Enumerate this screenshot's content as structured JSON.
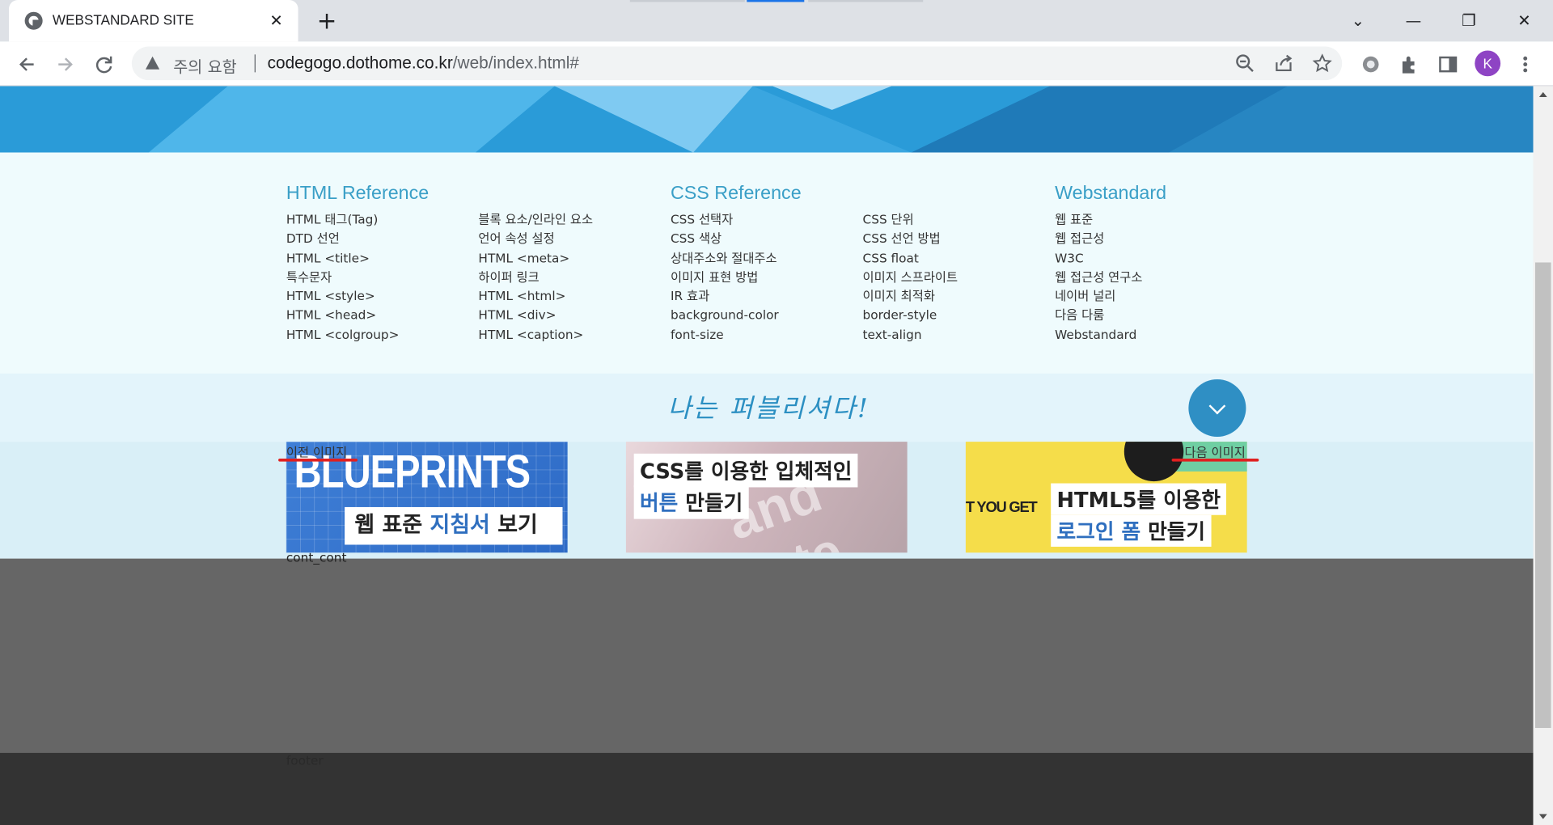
{
  "browser": {
    "tab_title": "WEBSTANDARD SITE",
    "tab_close_glyph": "✕",
    "new_tab_glyph": "+",
    "window_buttons": {
      "tab_search": "⌄",
      "minimize": "—",
      "restore": "❐",
      "close": "✕"
    },
    "security_warning": "주의 요함",
    "url_host": "codegogo.dothome.co.kr",
    "url_path": "/web/index.html#",
    "profile_initial": "K",
    "icons": {
      "back": "arrow-left-icon",
      "forward": "arrow-right-icon",
      "reload": "reload-icon",
      "warning": "warning-triangle-icon",
      "zoom": "zoom-out-icon",
      "share": "share-icon",
      "bookmark": "star-icon",
      "extension1": "gear-extension-icon",
      "extensions": "puzzle-icon",
      "side_panel": "side-panel-icon",
      "menu": "kebab-menu-icon"
    }
  },
  "references": {
    "html": {
      "title": "HTML Reference",
      "col1": [
        "HTML 태그(Tag)",
        "DTD 선언",
        "HTML <title>",
        "특수문자",
        "HTML <style>",
        "HTML <head>",
        "HTML <colgroup>"
      ],
      "col2": [
        "블록 요소/인라인 요소",
        "언어 속성 설정",
        "HTML <meta>",
        "하이퍼 링크",
        "HTML <html>",
        "HTML <div>",
        "HTML <caption>"
      ]
    },
    "css": {
      "title": "CSS Reference",
      "col1": [
        "CSS 선택자",
        "CSS 색상",
        "상대주소와 절대주소",
        "이미지 표현 방법",
        "IR 효과",
        "background-color",
        "font-size"
      ],
      "col2": [
        "CSS 단위",
        "CSS 선언 방법",
        "CSS float",
        "이미지 스프라이트",
        "이미지 최적화",
        "border-style",
        "text-align"
      ]
    },
    "webstandard": {
      "title": "Webstandard",
      "items": [
        "웹 표준",
        "웹 접근성",
        "W3C",
        "웹 접근성 연구소",
        "네이버 널리",
        "다음 다룸",
        "Webstandard"
      ]
    }
  },
  "slogan": "나는 퍼블리셔다!",
  "slider": {
    "prev_label": "이전 이미지",
    "next_label": "다음 이미지",
    "cards": [
      {
        "big_text": "BLUEPRINTS",
        "line1_a": "웹 표준 ",
        "line1_b": "지침서",
        "line1_c": " 보기"
      },
      {
        "bg_text": "and inte",
        "line1": "CSS를 이용한 입체적인",
        "line2_a": "버튼",
        "line2_b": " 만들기"
      },
      {
        "side_text": "T YOU GET",
        "line1": "HTML5를 이용한",
        "line2_a": "로그인 폼",
        "line2_b": " 만들기"
      }
    ]
  },
  "content_label": "cont_cont",
  "footer_label": "footer",
  "colors": {
    "accent": "#3a9fc7",
    "hero": "#2596d4",
    "content": "#666666",
    "footer": "#333333",
    "annotation_red": "#e02020"
  }
}
